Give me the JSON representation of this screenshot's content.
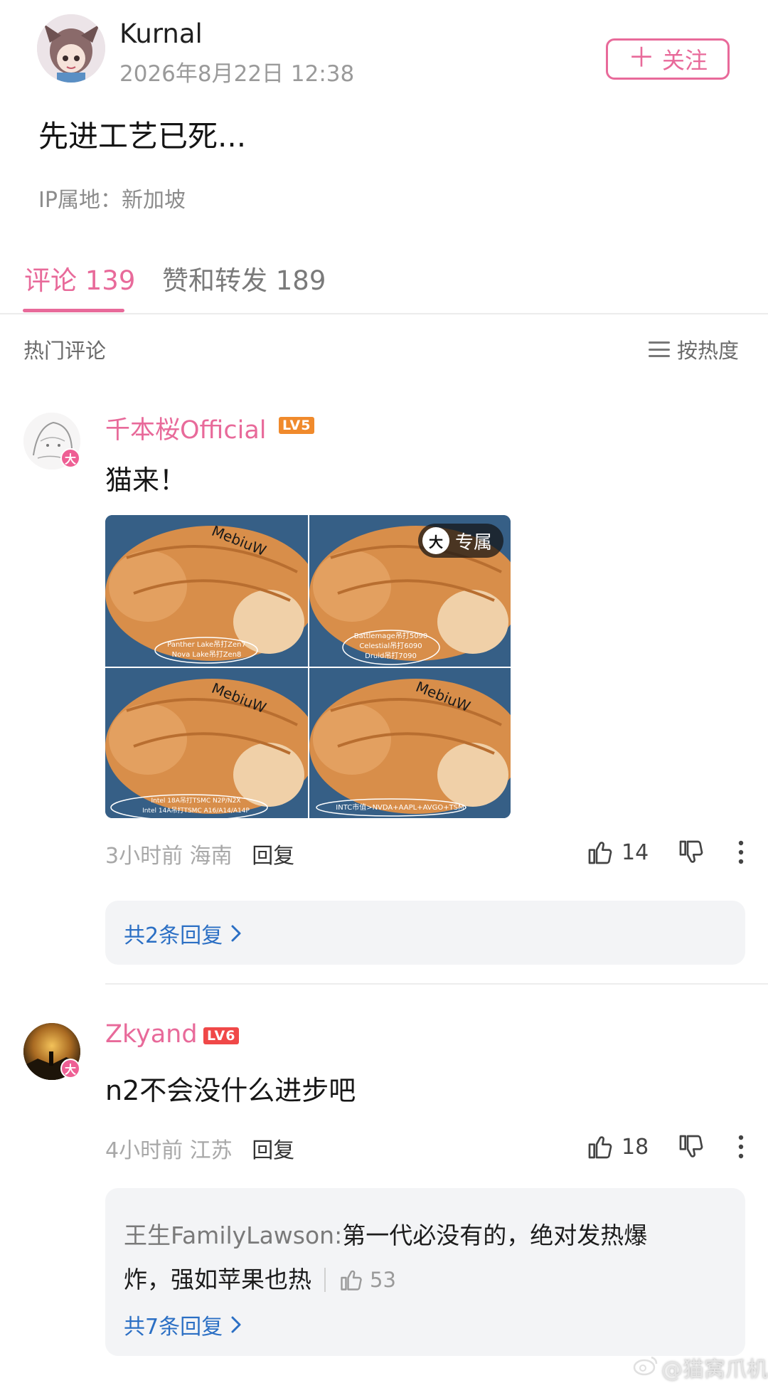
{
  "post": {
    "author": "Kurnal",
    "time": "2026年8月22日 12:38",
    "follow_label": "关注",
    "body": "先进工艺已死...",
    "ip": "IP属地：新加坡"
  },
  "tabs": [
    {
      "label": "评论 139",
      "active": true
    },
    {
      "label": "赞和转发 189",
      "active": false
    }
  ],
  "section": {
    "title": "热门评论",
    "sort_label": "按热度"
  },
  "comments": [
    {
      "user": "千本桜Official",
      "level": "LV5",
      "text": "猫来！",
      "images": [
        {
          "watermark": "MebiuW",
          "caption": [
            "Panther Lake吊打Zen7",
            "Nova Lake吊打Zen8"
          ]
        },
        {
          "watermark": "MebiuW",
          "caption": [
            "Battlemage吊打5090",
            "Celestial吊打6090",
            "Druid吊打7090"
          ],
          "badge": "专属"
        },
        {
          "watermark": "MebiuW",
          "caption": [
            "Intel 18A吊打TSMC N2P/N2X",
            "Intel 14A吊打TSMC A16/A14/A14P"
          ]
        },
        {
          "watermark": "MebiuW",
          "caption": [
            "INTC市值>NVDA+AAPL+AVGO+TSM"
          ]
        }
      ],
      "time": "3小时前",
      "location": "海南",
      "reply_label": "回复",
      "likes": "14",
      "replies_label": "共2条回复"
    },
    {
      "user": "Zkyand",
      "level": "LV6",
      "text": "n2不会没什么进步吧",
      "time": "4小时前",
      "location": "江苏",
      "reply_label": "回复",
      "likes": "18",
      "sub_reply": {
        "user": "王生FamilyLawson:",
        "text_line1": "第一代必没有的，绝对发热爆",
        "text_line2": "炸，强如苹果也热",
        "likes": "53"
      },
      "replies_label": "共7条回复"
    }
  ],
  "avatar_badge": "大",
  "watermark": "@猫窝爪机",
  "colors": {
    "accent": "#e86a9a",
    "link": "#2b6fc4",
    "lv5": "#f08a2c",
    "lv6": "#f04848"
  }
}
